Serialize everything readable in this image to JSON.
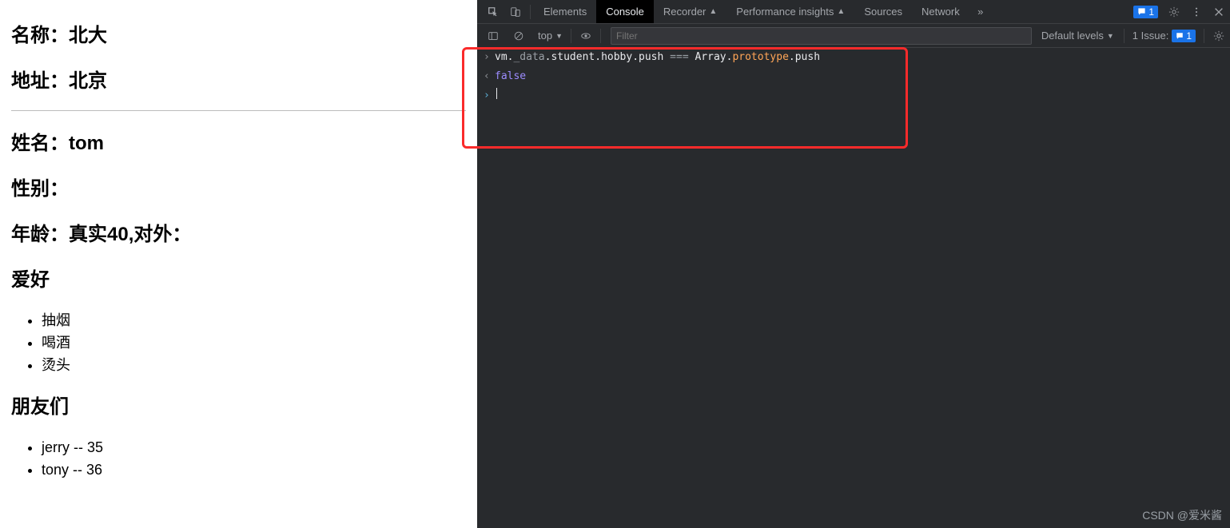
{
  "page": {
    "name_label": "名称：",
    "name_value": "北大",
    "addr_label": "地址：",
    "addr_value": "北京",
    "pname_label": "姓名：",
    "pname_value": "tom",
    "sex_label": "性别：",
    "sex_value": "",
    "age_label": "年龄：",
    "age_value": "真实40,对外：",
    "hobby_title": "爱好",
    "hobbies": [
      "抽烟",
      "喝酒",
      "烫头"
    ],
    "friends_title": "朋友们",
    "friends": [
      "jerry -- 35",
      "tony -- 36"
    ]
  },
  "devtools": {
    "tabs": {
      "elements": "Elements",
      "console": "Console",
      "recorder": "Recorder",
      "perf": "Performance insights",
      "sources": "Sources",
      "network": "Network"
    },
    "issue_badge": "1",
    "sub": {
      "context": "top",
      "filter_placeholder": "Filter",
      "levels": "Default levels",
      "issues_label": "1 Issue:",
      "issues_count": "1"
    },
    "console": {
      "input_parts": {
        "p1": "vm.",
        "p2": "_data",
        "p3": ".student.hobby.push",
        "p4": " === ",
        "p5": "Array.",
        "p6": "prototype",
        "p7": ".push"
      },
      "output": "false"
    },
    "watermark": "CSDN @爱米酱"
  }
}
